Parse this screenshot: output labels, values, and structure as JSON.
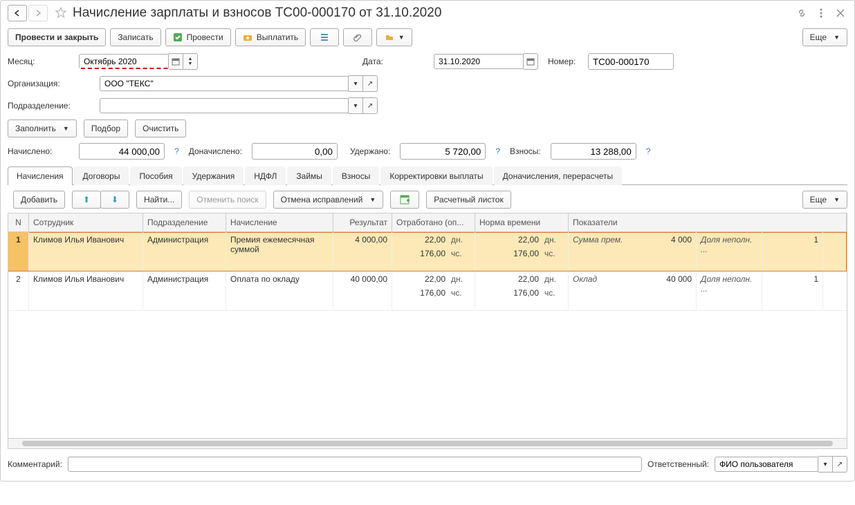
{
  "title": "Начисление зарплаты и взносов ТС00-000170 от 31.10.2020",
  "toolbar": {
    "post_close": "Провести и закрыть",
    "save": "Записать",
    "post": "Провести",
    "pay": "Выплатить",
    "more": "Еще"
  },
  "fields": {
    "month_lbl": "Месяц:",
    "month_val": "Октябрь 2020",
    "date_lbl": "Дата:",
    "date_val": "31.10.2020",
    "num_lbl": "Номер:",
    "num_val": "ТС00-000170",
    "org_lbl": "Организация:",
    "org_val": "ООО \"ТЕКС\"",
    "dep_lbl": "Подразделение:",
    "dep_val": ""
  },
  "actions": {
    "fill": "Заполнить",
    "pick": "Подбор",
    "clear": "Очистить"
  },
  "totals": {
    "acc_lbl": "Начислено:",
    "acc_val": "44 000,00",
    "add_lbl": "Доначислено:",
    "add_val": "0,00",
    "ded_lbl": "Удержано:",
    "ded_val": "5 720,00",
    "con_lbl": "Взносы:",
    "con_val": "13 288,00"
  },
  "tabs": [
    "Начисления",
    "Договоры",
    "Пособия",
    "Удержания",
    "НДФЛ",
    "Займы",
    "Взносы",
    "Корректировки выплаты",
    "Доначисления, перерасчеты"
  ],
  "tabtb": {
    "add": "Добавить",
    "find": "Найти...",
    "cancel_find": "Отменить поиск",
    "cancel_fix": "Отмена исправлений",
    "slip": "Расчетный листок",
    "more": "Еще"
  },
  "grid": {
    "headers": {
      "n": "N",
      "emp": "Сотрудник",
      "dep": "Подразделение",
      "ch": "Начисление",
      "res": "Результат",
      "ot": "Отработано (оп...",
      "no": "Норма времени",
      "ind": "Показатели"
    },
    "rows": [
      {
        "n": "1",
        "emp": "Климов Илья Иванович",
        "dep": "Администрация",
        "ch": "Премия ежемесячная суммой",
        "res": "4 000,00",
        "ot_d": "22,00",
        "ot_h": "176,00",
        "no_d": "22,00",
        "no_h": "176,00",
        "ind": "Сумма прем.",
        "ind_v": "4 000",
        "sh": "Доля неполн. ...",
        "last": "1",
        "sel": true
      },
      {
        "n": "2",
        "emp": "Климов Илья Иванович",
        "dep": "Администрация",
        "ch": "Оплата по окладу",
        "res": "40 000,00",
        "ot_d": "22,00",
        "ot_h": "176,00",
        "no_d": "22,00",
        "no_h": "176,00",
        "ind": "Оклад",
        "ind_v": "40 000",
        "sh": "Доля неполн. ...",
        "last": "1",
        "sel": false
      }
    ],
    "units": {
      "d": "дн.",
      "h": "чс."
    }
  },
  "footer": {
    "cmt_lbl": "Комментарий:",
    "resp_lbl": "Ответственный:",
    "resp_val": "ФИО пользователя"
  }
}
